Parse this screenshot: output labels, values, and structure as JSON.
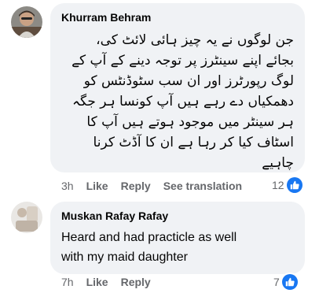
{
  "comments": [
    {
      "author": "Khurram Behram",
      "text_lines": [
        "جن لوگوں نے یہ چیز ہائی لائٹ کی،",
        "بجائے اپنے سینٹرز پر توجہ دینے کے آپ کے",
        "لوگ رپورٹرز اور ان سب سٹوڈنٹس کو",
        "دھمکیاں دے رہے ہیں آپ کونسا ہر جگہ",
        "ہر سینٹر میں موجود ہوتے ہیں آپ کا",
        "اسٹاف کیا کر رہا ہے ان کا آڈٹ کرنا",
        "چاہیے"
      ],
      "time": "3h",
      "like": "Like",
      "reply": "Reply",
      "translate": "See translation",
      "reaction_count": "12",
      "reaction_icon": "thumbs-up-icon"
    },
    {
      "author": "Muskan Rafay Rafay",
      "text_lines": [
        "Heard and had practicle as well",
        "with my maid daughter"
      ],
      "time": "7h",
      "like": "Like",
      "reply": "Reply",
      "reaction_count": "7",
      "reaction_icon": "thumbs-up-icon"
    }
  ],
  "colors": {
    "bubble_bg": "#f0f2f5",
    "meta_text": "#65676b",
    "like_blue": "#1877f2"
  }
}
